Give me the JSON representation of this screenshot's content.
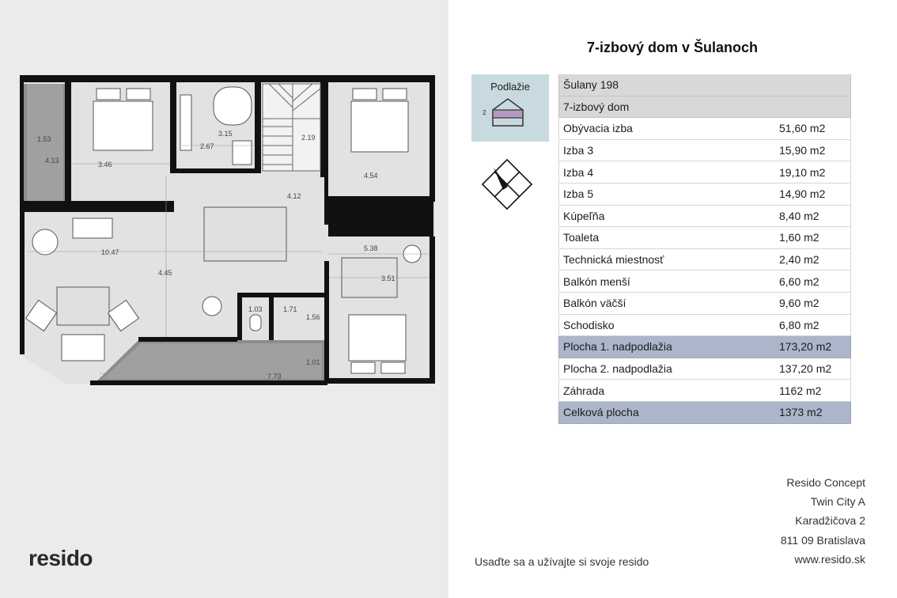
{
  "title": "7-izbový dom v Šulanoch",
  "floor": {
    "label": "Podlažie",
    "number": "2"
  },
  "info_header": [
    "Šulany 198",
    "7-izbový dom"
  ],
  "rooms": [
    {
      "name": "Obývacia izba",
      "area": "51,60 m2"
    },
    {
      "name": "Izba 3",
      "area": "15,90 m2"
    },
    {
      "name": "Izba 4",
      "area": "19,10 m2"
    },
    {
      "name": "Izba 5",
      "area": "14,90 m2"
    },
    {
      "name": "Kúpeľňa",
      "area": "8,40 m2"
    },
    {
      "name": "Toaleta",
      "area": "1,60 m2"
    },
    {
      "name": "Technická miestnosť",
      "area": "2,40 m2"
    },
    {
      "name": "Balkón menší",
      "area": "6,60 m2"
    },
    {
      "name": "Balkón väčší",
      "area": "9,60 m2"
    },
    {
      "name": "Schodisko",
      "area": "6,80 m2"
    }
  ],
  "totals": [
    {
      "name": "Plocha 1. nadpodlažia",
      "area": "173,20 m2",
      "highlight": true
    },
    {
      "name": "Plocha 2. nadpodlažia",
      "area": "137,20 m2",
      "highlight": false
    },
    {
      "name": "Záhrada",
      "area": "1162 m2",
      "highlight": false
    },
    {
      "name": "Celková plocha",
      "area": "1373 m2",
      "highlight": true
    }
  ],
  "plan_dimensions": [
    "1.53",
    "4.13",
    "3.46",
    "3.15",
    "2.67",
    "2.19",
    "4.54",
    "4.12",
    "10.47",
    "5.38",
    "3.51",
    "4.45",
    "1.03",
    "1.71",
    "1.56",
    "1.01",
    "7.73"
  ],
  "logo": "resido",
  "slogan": "Usaďte sa a užívajte si svoje resido",
  "address": [
    "Resido Concept",
    "Twin City A",
    "Karadžičova 2",
    "811 09 Bratislava",
    "www.resido.sk"
  ],
  "colors": {
    "left_bg": "#ebebeb",
    "floor_box": "#c8d9df",
    "floor_highlight": "#b79ac2",
    "highlight_row": "#abb6ca",
    "header_row": "#d8d8d8"
  }
}
